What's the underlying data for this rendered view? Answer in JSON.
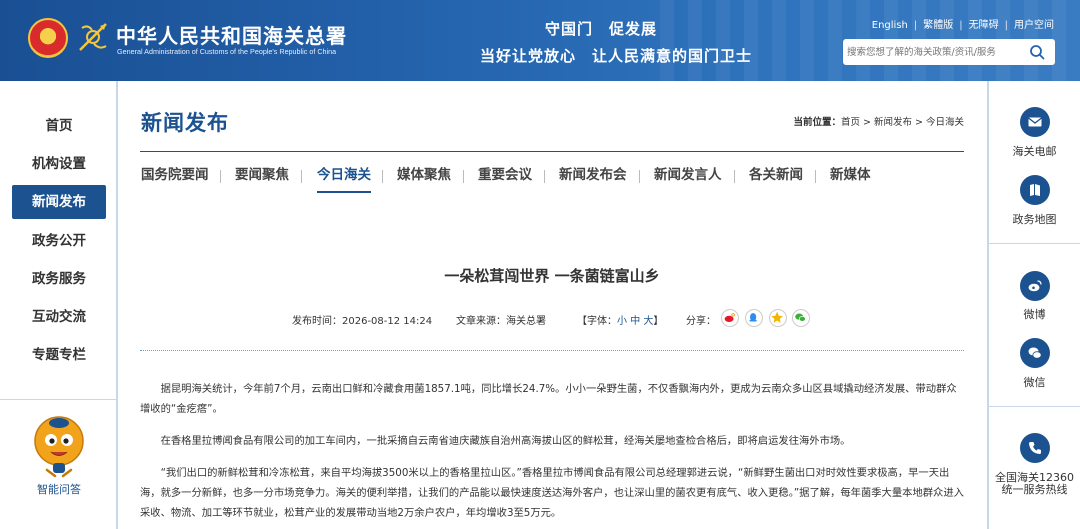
{
  "header": {
    "brand_cn": "中华人民共和国海关总署",
    "brand_en": "General Administration of Customs of the People's Republic of China",
    "slogan_1": "守国门　促发展",
    "slogan_2": "当好让党放心　让人民满意的国门卫士",
    "top_links": [
      "English",
      "繁體版",
      "无障碍",
      "用户空间"
    ],
    "search_placeholder": "搜索您想了解的海关政策/资讯/服务"
  },
  "left_nav": {
    "items": [
      {
        "label": "首页",
        "active": false
      },
      {
        "label": "机构设置",
        "active": false
      },
      {
        "label": "新闻发布",
        "active": true
      },
      {
        "label": "政务公开",
        "active": false
      },
      {
        "label": "政务服务",
        "active": false
      },
      {
        "label": "互动交流",
        "active": false
      },
      {
        "label": "专题专栏",
        "active": false
      }
    ],
    "assistant_label": "智能问答"
  },
  "right_rail": {
    "items": [
      {
        "label": "海关电邮",
        "icon": "mail-icon"
      },
      {
        "label": "政务地图",
        "icon": "map-icon"
      },
      {
        "label": "微博",
        "icon": "weibo-icon"
      },
      {
        "label": "微信",
        "icon": "wechat-icon"
      },
      {
        "label": "全国海关12360统一服务热线",
        "icon": "phone-icon"
      }
    ]
  },
  "main": {
    "section_title": "新闻发布",
    "breadcrumb": {
      "prefix": "当前位置：",
      "path": "首页 > 新闻发布 > 今日海关"
    },
    "tabs": [
      {
        "label": "国务院要闻",
        "active": false
      },
      {
        "label": "要闻聚焦",
        "active": false
      },
      {
        "label": "今日海关",
        "active": true
      },
      {
        "label": "媒体聚焦",
        "active": false
      },
      {
        "label": "重要会议",
        "active": false
      },
      {
        "label": "新闻发布会",
        "active": false
      },
      {
        "label": "新闻发言人",
        "active": false
      },
      {
        "label": "各关新闻",
        "active": false
      },
      {
        "label": "新媒体",
        "active": false
      }
    ],
    "article": {
      "title": "一朵松茸闯世界 一条菌链富山乡",
      "publish_time_label": "发布时间：",
      "publish_time": "2026-08-12 14:24",
      "source_label": "文章来源：",
      "source": "海关总署",
      "font_label_open": "【字体：",
      "font_small": "小",
      "font_medium": "中",
      "font_large": "大",
      "font_label_close": "】",
      "share_label": "分享：",
      "paragraphs": [
        "据昆明海关统计，今年前7个月，云南出口鲜和冷藏食用菌1857.1吨，同比增长24.7%。小小一朵野生菌，不仅香飘海内外，更成为云南众多山区县域撬动经济发展、带动群众增收的“金疙瘩”。",
        "在香格里拉博闻食品有限公司的加工车间内，一批采摘自云南省迪庆藏族自治州高海拔山区的鲜松茸，经海关屡地查检合格后，即将启运发往海外市场。",
        "“我们出口的新鲜松茸和冷冻松茸，来自平均海拔3500米以上的香格里拉山区。”香格里拉市博闻食品有限公司总经理郭进云说，“新鲜野生菌出口对时效性要求极高，早一天出海，就多一分新鲜，也多一分市场竞争力。海关的便利举措，让我们的产品能以最快速度送达海外客户，也让深山里的菌农更有底气、收入更稳。”据了解，每年菌季大量本地群众进入采收、物流、加工等环节就业，松茸产业的发展带动当地2万余户农户，年均增收3至5万元。"
      ]
    }
  },
  "colors": {
    "brand_blue": "#1c528f",
    "header_blue": "#2463ad",
    "rule": "#c9d7ea"
  }
}
